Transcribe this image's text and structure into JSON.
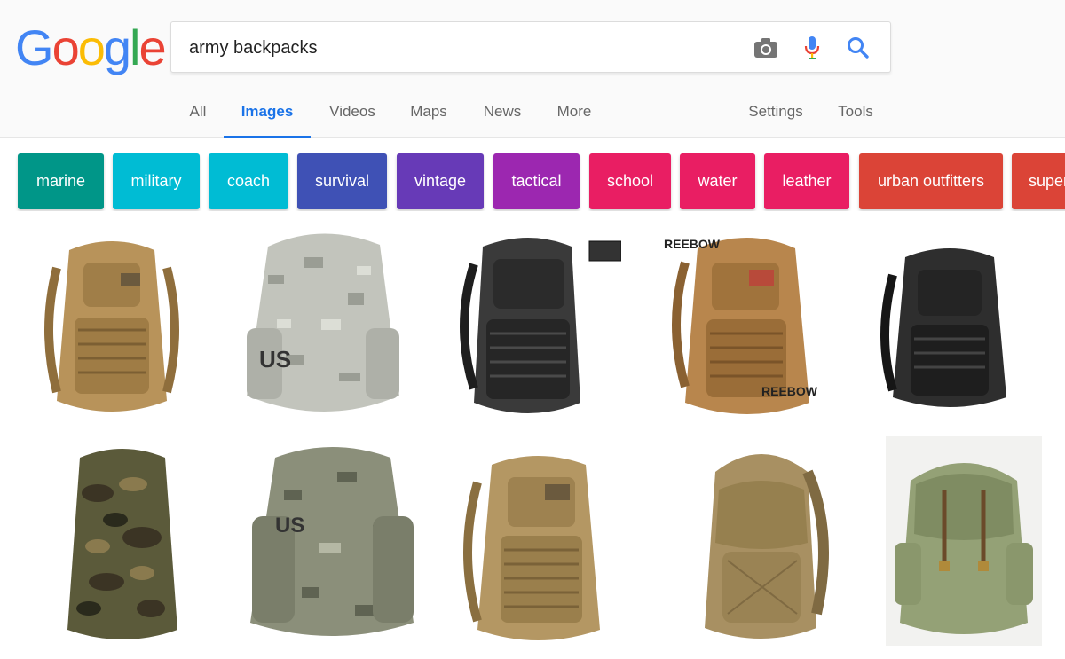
{
  "logo": {
    "letters": [
      "G",
      "o",
      "o",
      "g",
      "l",
      "e"
    ],
    "colors": [
      "#4285F4",
      "#EA4335",
      "#FBBC05",
      "#4285F4",
      "#34A853",
      "#EA4335"
    ]
  },
  "search": {
    "query": "army backpacks",
    "icons": [
      "camera-icon",
      "microphone-icon",
      "search-icon"
    ]
  },
  "tabs": {
    "items": [
      "All",
      "Images",
      "Videos",
      "Maps",
      "News",
      "More"
    ],
    "active": "Images",
    "right": [
      "Settings",
      "Tools"
    ]
  },
  "chips": [
    {
      "label": "marine",
      "color": "#009688"
    },
    {
      "label": "military",
      "color": "#00BCD4"
    },
    {
      "label": "coach",
      "color": "#00BCD4"
    },
    {
      "label": "survival",
      "color": "#3F51B5"
    },
    {
      "label": "vintage",
      "color": "#673AB7"
    },
    {
      "label": "tactical",
      "color": "#9C27B0"
    },
    {
      "label": "school",
      "color": "#E91E63"
    },
    {
      "label": "water",
      "color": "#E91E63"
    },
    {
      "label": "leather",
      "color": "#E91E63"
    },
    {
      "label": "urban outfitters",
      "color": "#DB4437"
    },
    {
      "label": "super",
      "color": "#DB4437"
    }
  ],
  "images": [
    {
      "desc": "tan tactical backpack with flag patch",
      "colors": [
        "#b8935a",
        "#8f6e3c"
      ]
    },
    {
      "desc": "digital camo US backpack",
      "colors": [
        "#c2c4bc",
        "#8e918a"
      ]
    },
    {
      "desc": "black tactical backpack",
      "colors": [
        "#3a3a3a",
        "#1e1e1e"
      ]
    },
    {
      "desc": "tan REEBOW tactical backpack",
      "colors": [
        "#b8864d",
        "#8a6132"
      ]
    },
    {
      "desc": "black assault backpack",
      "colors": [
        "#2e2e2e",
        "#161616"
      ]
    },
    {
      "desc": "woodland camo hiking backpack",
      "colors": [
        "#5b5a3a",
        "#3b3424"
      ]
    },
    {
      "desc": "digital camo US rucksack",
      "colors": [
        "#8b8f7a",
        "#5f6352"
      ]
    },
    {
      "desc": "coyote tan tactical backpack with flag",
      "colors": [
        "#b49763",
        "#8a6f40"
      ]
    },
    {
      "desc": "tan daypack",
      "colors": [
        "#a89062",
        "#7f6a42"
      ]
    },
    {
      "desc": "vintage green canvas rucksack",
      "colors": [
        "#94a176",
        "#6e7a55"
      ]
    }
  ],
  "overlays": {
    "brand_text": "REEBOW"
  }
}
